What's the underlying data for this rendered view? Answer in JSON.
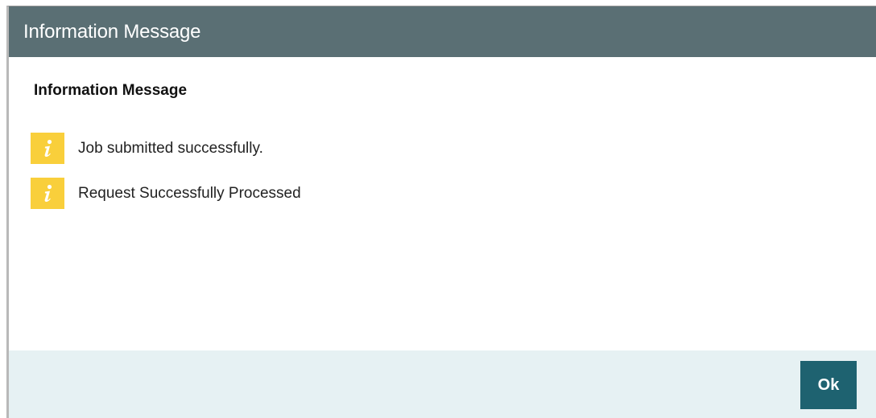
{
  "dialog": {
    "title": "Information Message",
    "heading": "Information Message",
    "messages": [
      {
        "icon": "info-icon",
        "text": "Job submitted successfully."
      },
      {
        "icon": "info-icon",
        "text": "Request Successfully Processed"
      }
    ],
    "ok_label": "Ok"
  },
  "colors": {
    "titlebar": "#5a6f74",
    "info_icon_bg": "#f9cf3b",
    "footer_bg": "#e6f1f3",
    "ok_button_bg": "#1e6270"
  }
}
